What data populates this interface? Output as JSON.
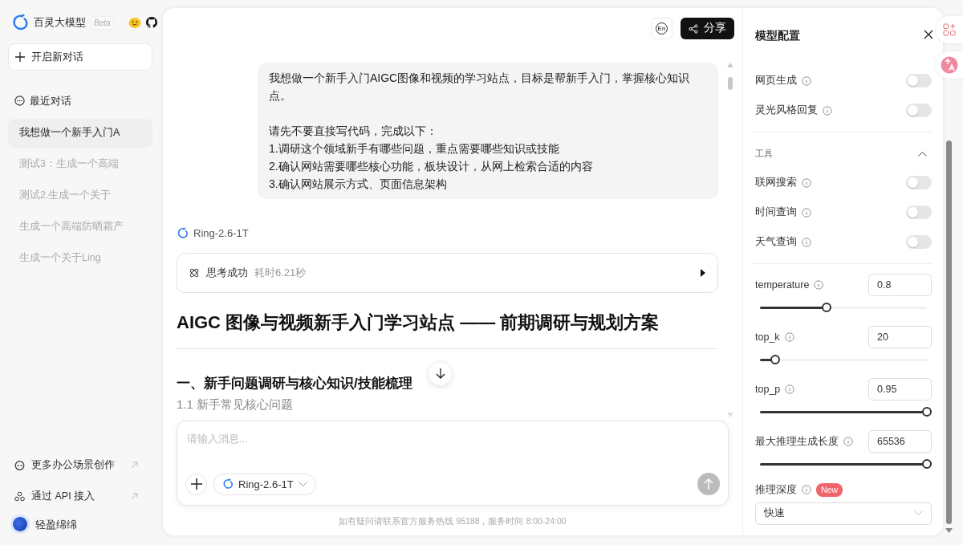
{
  "sidebar": {
    "brand": "百灵大模型",
    "badge": "Beta",
    "new_chat": "开启新对话",
    "recent_title": "最近对话",
    "conversations": [
      {
        "title": "我想做一个新手入门A",
        "selected": true
      },
      {
        "title": "测试3：生成一个高端",
        "selected": false
      },
      {
        "title": "测试2.生成一个关于",
        "selected": false
      },
      {
        "title": "生成一个高端防晒霜产",
        "selected": false
      },
      {
        "title": "生成一个关于Ling",
        "selected": false
      }
    ],
    "links": [
      {
        "kind": "office",
        "label": "更多办公场景创作"
      },
      {
        "kind": "api",
        "label": "通过 API 接入"
      }
    ],
    "user": {
      "name": "轻盈绵绵"
    }
  },
  "chat": {
    "lang_button": "En",
    "share_button": "分享",
    "user_message": [
      "我想做一个新手入门AIGC图像和视频的学习站点，目标是帮新手入门，掌握核心知识点。",
      "请先不要直接写代码，完成以下：\n1.调研这个领域新手有哪些问题，重点需要哪些知识或技能\n2.确认网站需要哪些核心功能，板块设计，从网上检索合适的内容\n3.确认网站展示方式、页面信息架构"
    ],
    "reply": {
      "model": "Ring-2.6-1T",
      "thinking": {
        "status": "思考成功",
        "duration": "耗时6.21秒",
        "expanded": false
      },
      "title": "AIGC 图像与视频新手入门学习站点 —— 前期调研与规划方案",
      "section_heading": "一、新手问题调研与核心知识/技能梳理",
      "subheading": "1.1 新手常见核心问题"
    }
  },
  "composer": {
    "placeholder": "请输入消息...",
    "model": "Ring-2.6-1T"
  },
  "footer": "如有疑问请联系官方服务热线 95188，服务时间 8:00-24:00",
  "config": {
    "title": "模型配置",
    "switches": [
      {
        "label": "网页生成",
        "on": false
      },
      {
        "label": "灵光风格回复",
        "on": false
      }
    ],
    "tools": {
      "title": "工具",
      "expanded": true,
      "switches": [
        {
          "label": "联网搜索",
          "on": false
        },
        {
          "label": "时间查询",
          "on": false
        },
        {
          "label": "天气查询",
          "on": false
        }
      ]
    },
    "params": [
      {
        "label": "temperature",
        "value": "0.8",
        "level": 0.4
      },
      {
        "label": "top_k",
        "value": "20",
        "level": 0.09
      },
      {
        "label": "top_p",
        "value": "0.95",
        "level": 1
      },
      {
        "label": "最大推理生成长度",
        "value": "65536",
        "level": 1
      }
    ],
    "depth": {
      "label": "推理深度",
      "badge": "New",
      "value": "快速"
    }
  }
}
